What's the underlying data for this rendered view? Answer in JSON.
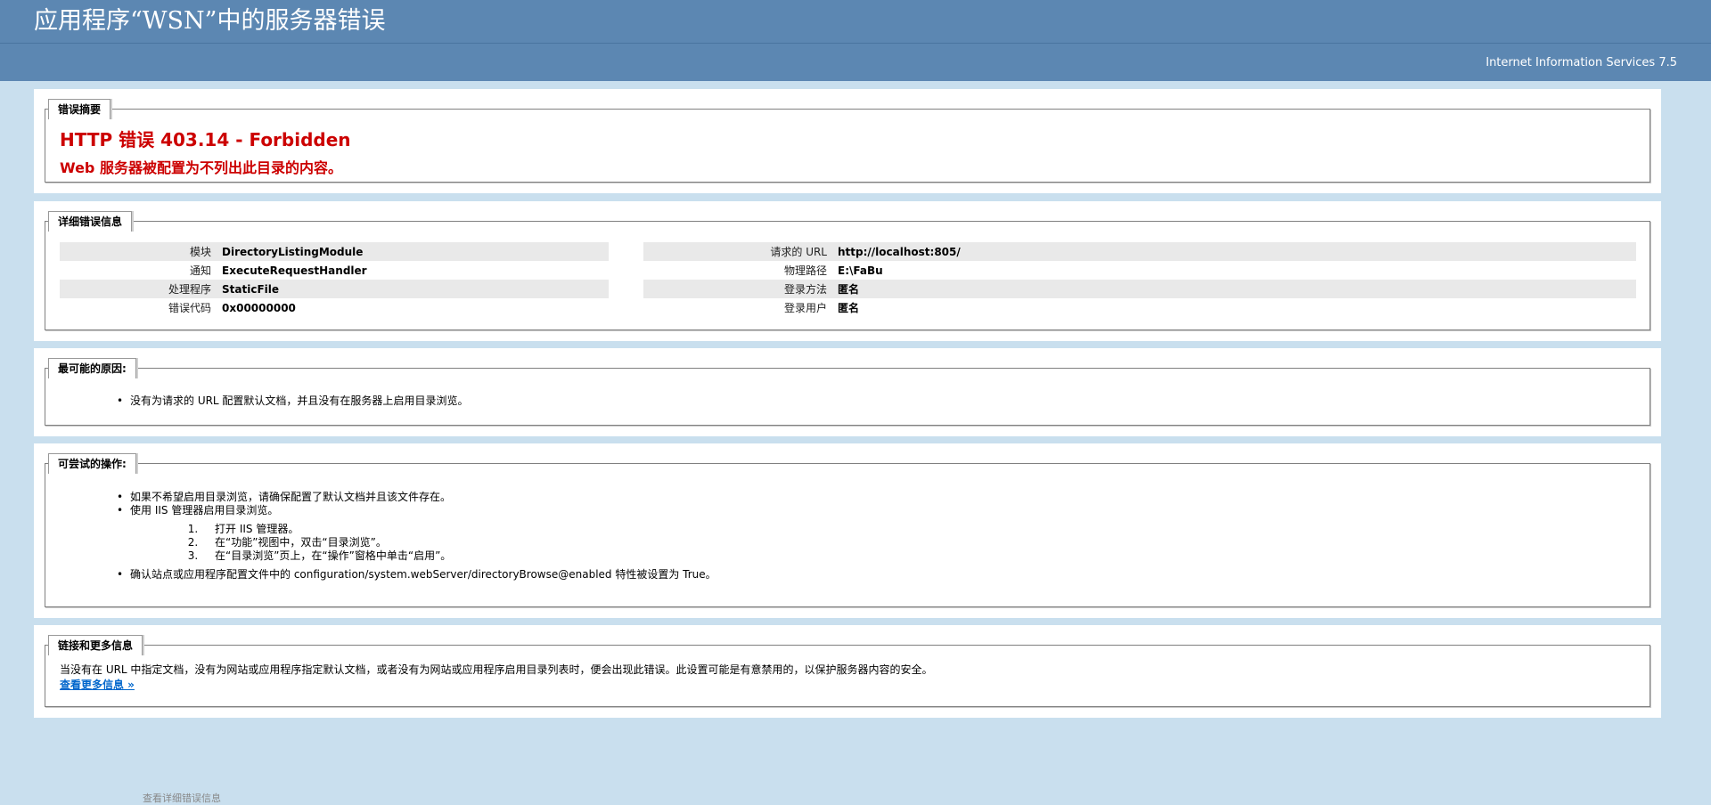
{
  "header": {
    "title": "应用程序“WSN”中的服务器错误",
    "product": "Internet Information Services 7.5"
  },
  "summary": {
    "legend": "错误摘要",
    "title": "HTTP 错误 403.14 - Forbidden",
    "message": "Web 服务器被配置为不列出此目录的内容。"
  },
  "details": {
    "legend": "详细错误信息",
    "left": [
      {
        "label": "模块",
        "value": "DirectoryListingModule"
      },
      {
        "label": "通知",
        "value": "ExecuteRequestHandler"
      },
      {
        "label": "处理程序",
        "value": "StaticFile"
      },
      {
        "label": "错误代码",
        "value": "0x00000000"
      }
    ],
    "right": [
      {
        "label": "请求的 URL",
        "value": "http://localhost:805/"
      },
      {
        "label": "物理路径",
        "value": "E:\\FaBu"
      },
      {
        "label": "登录方法",
        "value": "匿名"
      },
      {
        "label": "登录用户",
        "value": "匿名"
      }
    ]
  },
  "causes": {
    "legend": "最可能的原因:",
    "items": [
      "没有为请求的 URL 配置默认文档，并且没有在服务器上启用目录浏览。"
    ]
  },
  "actions": {
    "legend": "可尝试的操作:",
    "item1": "如果不希望启用目录浏览，请确保配置了默认文档并且该文件存在。",
    "item2": "使用 IIS 管理器启用目录浏览。",
    "steps": [
      "打开 IIS 管理器。",
      "在“功能”视图中，双击“目录浏览”。",
      "在“目录浏览”页上，在“操作”窗格中单击“启用”。"
    ],
    "item3": "确认站点或应用程序配置文件中的 configuration/system.webServer/directoryBrowse@enabled 特性被设置为 True。"
  },
  "links": {
    "legend": "链接和更多信息",
    "text": "当没有在 URL 中指定文档，没有为网站或应用程序指定默认文档，或者没有为网站或应用程序启用目录列表时，便会出现此错误。此设置可能是有意禁用的，以保护服务器内容的安全。",
    "more": "查看更多信息 »"
  },
  "footer": {
    "text": "查看详细错误信息"
  }
}
